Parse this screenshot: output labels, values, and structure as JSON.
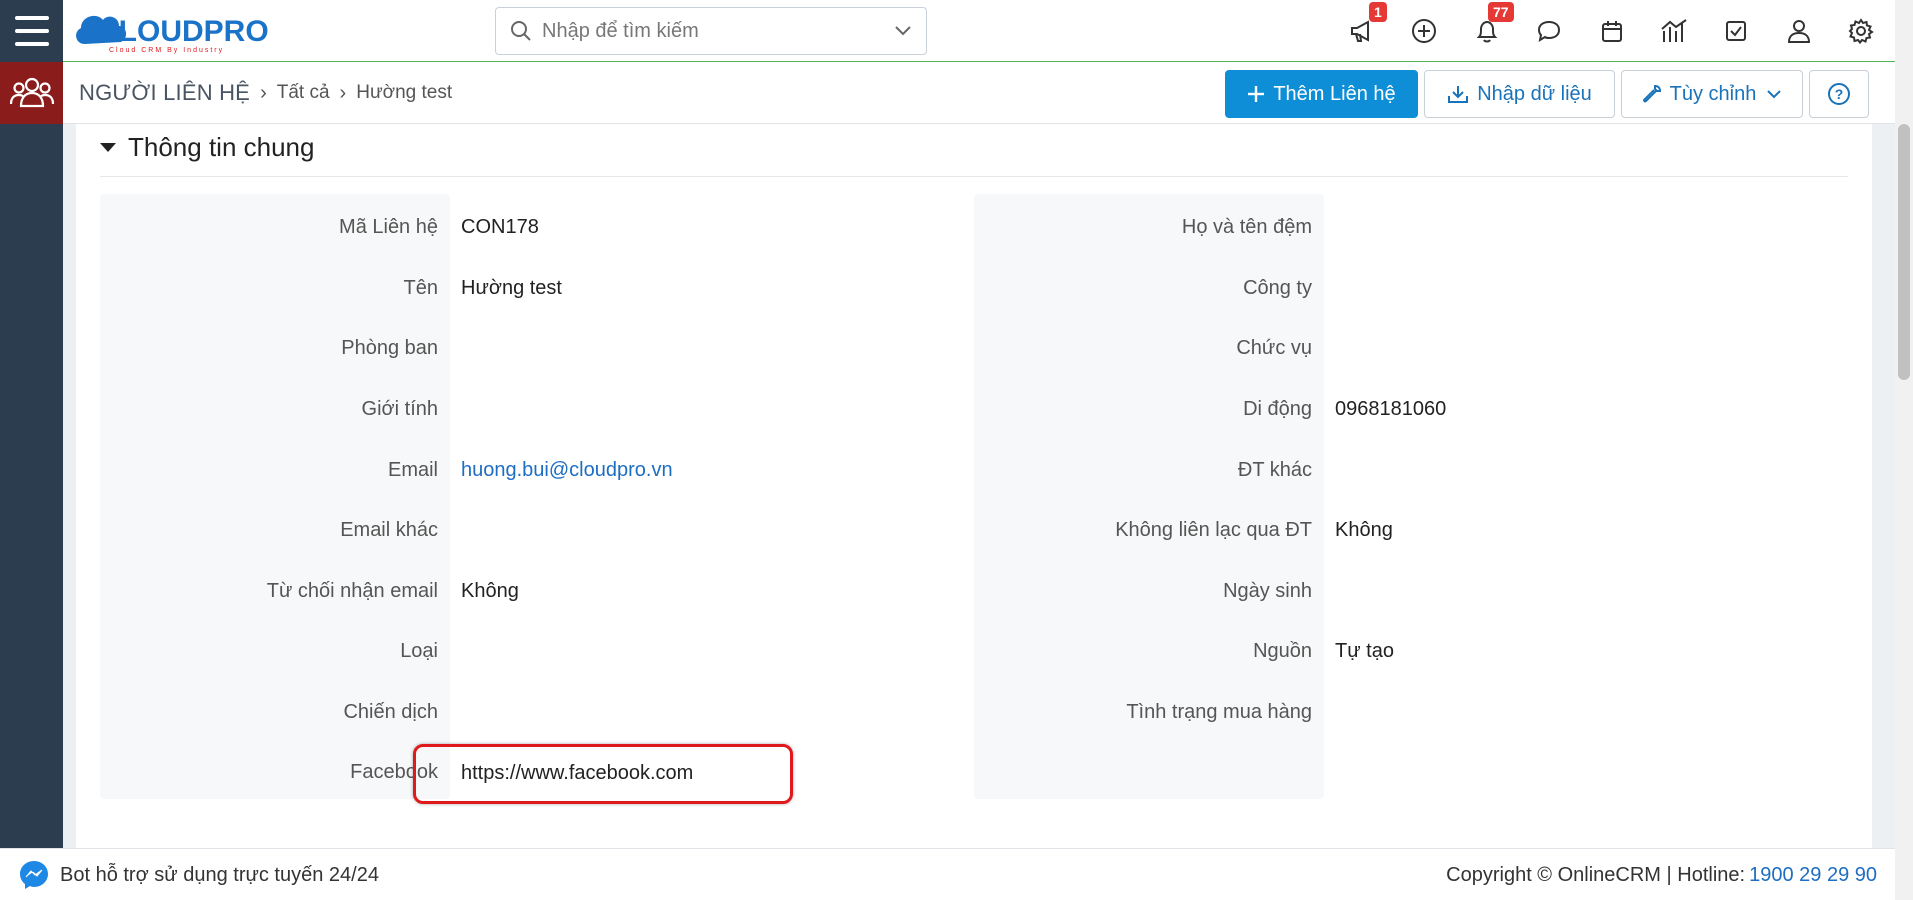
{
  "header": {
    "logo_text": "CLOUDPRO",
    "logo_tagline": "Cloud CRM By Industry",
    "search_placeholder": "Nhập để tìm kiếm",
    "badges": {
      "announcements": "1",
      "notifications": "77"
    }
  },
  "subheader": {
    "breadcrumb": {
      "module": "NGƯỜI LIÊN HỆ",
      "list": "Tất cả",
      "record": "Hường test"
    },
    "buttons": {
      "add_contact": "Thêm Liên hệ",
      "import": "Nhập dữ liệu",
      "customize": "Tùy chỉnh"
    }
  },
  "section": {
    "title": "Thông tin chung",
    "left_fields": [
      {
        "label": "Mã Liên hệ",
        "value": "CON178"
      },
      {
        "label": "Tên",
        "value": "Hường test"
      },
      {
        "label": "Phòng ban",
        "value": ""
      },
      {
        "label": "Giới tính",
        "value": ""
      },
      {
        "label": "Email",
        "value": "huong.bui@cloudpro.vn"
      },
      {
        "label": "Email khác",
        "value": ""
      },
      {
        "label": "Từ chối nhận email",
        "value": "Không"
      },
      {
        "label": "Loại",
        "value": ""
      },
      {
        "label": "Chiến dịch",
        "value": ""
      },
      {
        "label": "Facebook",
        "value": "https://www.facebook.com"
      }
    ],
    "right_fields": [
      {
        "label": "Họ và tên đệm",
        "value": ""
      },
      {
        "label": "Công ty",
        "value": ""
      },
      {
        "label": "Chức vụ",
        "value": ""
      },
      {
        "label": "Di động",
        "value": "0968181060"
      },
      {
        "label": "ĐT khác",
        "value": ""
      },
      {
        "label": "Không liên lạc qua ĐT",
        "value": "Không"
      },
      {
        "label": "Ngày sinh",
        "value": ""
      },
      {
        "label": "Nguồn",
        "value": "Tự tạo"
      },
      {
        "label": "Tình trạng mua hàng",
        "value": ""
      }
    ]
  },
  "footer": {
    "bot_text": "Bot hỗ trợ sử dụng trực tuyến 24/24",
    "copyright": "Copyright © OnlineCRM | Hotline:",
    "hotline": "1900 29 29 90"
  },
  "colors": {
    "primary": "#0e8ed6",
    "rail": "#2c3d4f",
    "module_active": "#8b1c1c",
    "highlight": "#e0191c"
  }
}
